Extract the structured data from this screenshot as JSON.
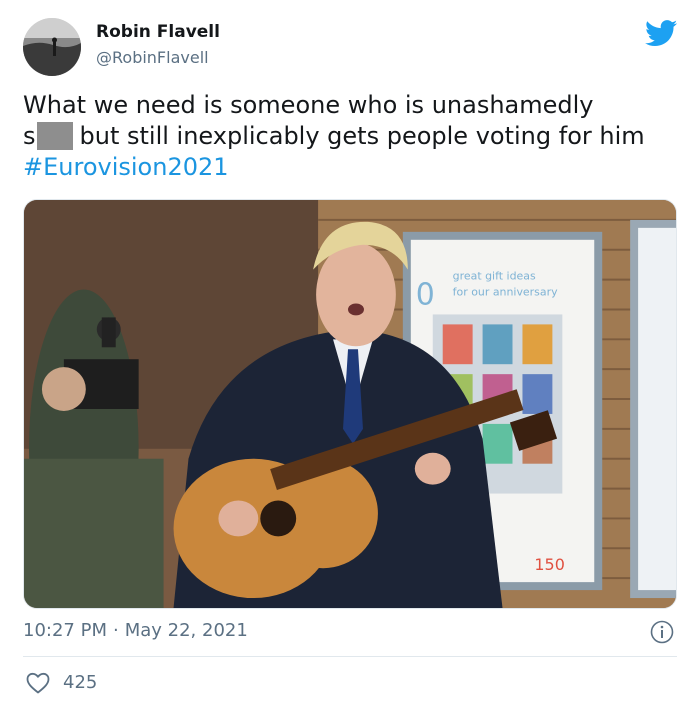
{
  "author": {
    "name": "Robin Flavell",
    "handle": "@RobinFlavell"
  },
  "tweet": {
    "line1": "What we need is someone who is unashamedly",
    "line2_prefix": "s",
    "line2_suffix": "but still inexplicably gets people voting for him",
    "hashtag": "#Eurovision2021"
  },
  "photo": {
    "poster_text_line1": "great gift ideas",
    "poster_text_line2": "for our anniversary",
    "poster_number": "150"
  },
  "meta": {
    "time": "10:27 PM",
    "separator": "·",
    "date": "May 22, 2021"
  },
  "engagement": {
    "likes": "425"
  },
  "colors": {
    "link": "#1b95e0",
    "muted": "#5b7083",
    "twitter_blue": "#1da1f2"
  },
  "icons": {
    "brand": "twitter-bird-icon",
    "info": "info-icon",
    "like": "heart-icon"
  }
}
